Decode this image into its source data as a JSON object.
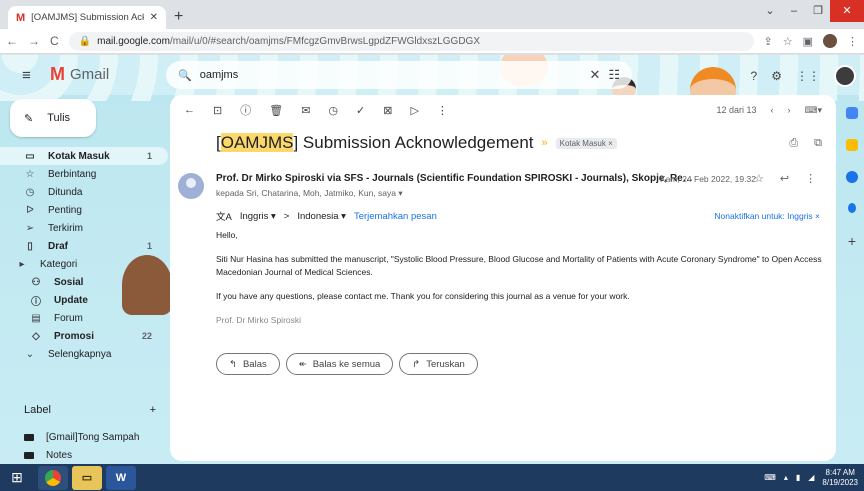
{
  "browser": {
    "tab_title": "[OAMJMS] Submission Acknow",
    "tab_close": "✕",
    "new_tab": "+",
    "url_host": "mail.google.com",
    "url_path": "/mail/u/0/#search/oamjms/FMfcgzGmvBrwsLgpdZFWGldxszLGGDGX",
    "window_controls": [
      "⌄",
      "–",
      "❐",
      "✕"
    ]
  },
  "gmail": {
    "product_name": "Gmail",
    "search_value": "oamjms",
    "compose_label": "Tulis",
    "nav": [
      {
        "icon": "inbox-icon",
        "glyph": "▭",
        "label": "Kotak Masuk",
        "count": "1",
        "bold": true
      },
      {
        "icon": "star-icon",
        "glyph": "☆",
        "label": "Berbintang",
        "count": "",
        "bold": false
      },
      {
        "icon": "clock-icon",
        "glyph": "◷",
        "label": "Ditunda",
        "count": "",
        "bold": false
      },
      {
        "icon": "important-icon",
        "glyph": "ᐅ",
        "label": "Penting",
        "count": "",
        "bold": false
      },
      {
        "icon": "send-icon",
        "glyph": "➢",
        "label": "Terkirim",
        "count": "",
        "bold": false
      },
      {
        "icon": "draft-icon",
        "glyph": "▯",
        "label": "Draf",
        "count": "1",
        "bold": true
      },
      {
        "icon": "category-icon",
        "glyph": "▸",
        "label": "Kategori",
        "count": "",
        "bold": false
      },
      {
        "icon": "social-icon",
        "glyph": "⚇",
        "label": "Sosial",
        "count": "",
        "bold": true
      },
      {
        "icon": "update-icon",
        "glyph": "ⓘ",
        "label": "Update",
        "count": "",
        "bold": true
      },
      {
        "icon": "forum-icon",
        "glyph": "▤",
        "label": "Forum",
        "count": "",
        "bold": false
      },
      {
        "icon": "promo-icon",
        "glyph": "◇",
        "label": "Promosi",
        "count": "22",
        "bold": true
      },
      {
        "icon": "chevron-down-icon",
        "glyph": "⌄",
        "label": "Selengkapnya",
        "count": "",
        "bold": false
      }
    ],
    "labels_heading": "Label",
    "labels_add": "+",
    "labels": [
      "[Gmail]Tong Sampah",
      "Notes"
    ]
  },
  "email": {
    "subject_highlight": "OAMJMS",
    "subject_rest": " Submission Acknowledgement",
    "subject_open": "[",
    "subject_close": "]",
    "chip": "Kotak Masuk ×",
    "pagination": "12 dari 13",
    "from": "Prof. Dr Mirko Spiroski via SFS - Journals (Scientific Foundation SPIROSKI - Journals), Skopje, Repu...",
    "date": "Kam, 24 Feb 2022, 19.32",
    "to": "kepada Sri, Chatarina, Moh, Jatmiko, Kun, saya ▾",
    "translate": {
      "from_lang": "Inggris ▾",
      "arrow": ">",
      "to_lang": "Indonesia ▾",
      "action": "Terjemahkan pesan",
      "disable": "Nonaktifkan untuk: Inggris ×"
    },
    "greeting": "Hello,",
    "para1": "Siti Nur Hasina has submitted the manuscript, \"Systolic Blood Pressure, Blood Glucose and Mortality of Patients with Acute Coronary Syndrome\" to Open Access Macedonian Journal of Medical Sciences.",
    "para2": "If you have any questions, please contact me. Thank you for considering this journal as a venue for your work.",
    "signature": "Prof. Dr Mirko Spiroski",
    "reply_label": "Balas",
    "reply_all_label": "Balas ke semua",
    "forward_label": "Teruskan"
  },
  "taskbar": {
    "time": "8:47 AM",
    "date": "8/19/2023",
    "word_app": "W"
  },
  "colors": {
    "accent": "#1a73e8",
    "gmail_red": "#ea4335",
    "highlight": "#fcd76a",
    "taskbar": "#1f3a5f"
  }
}
